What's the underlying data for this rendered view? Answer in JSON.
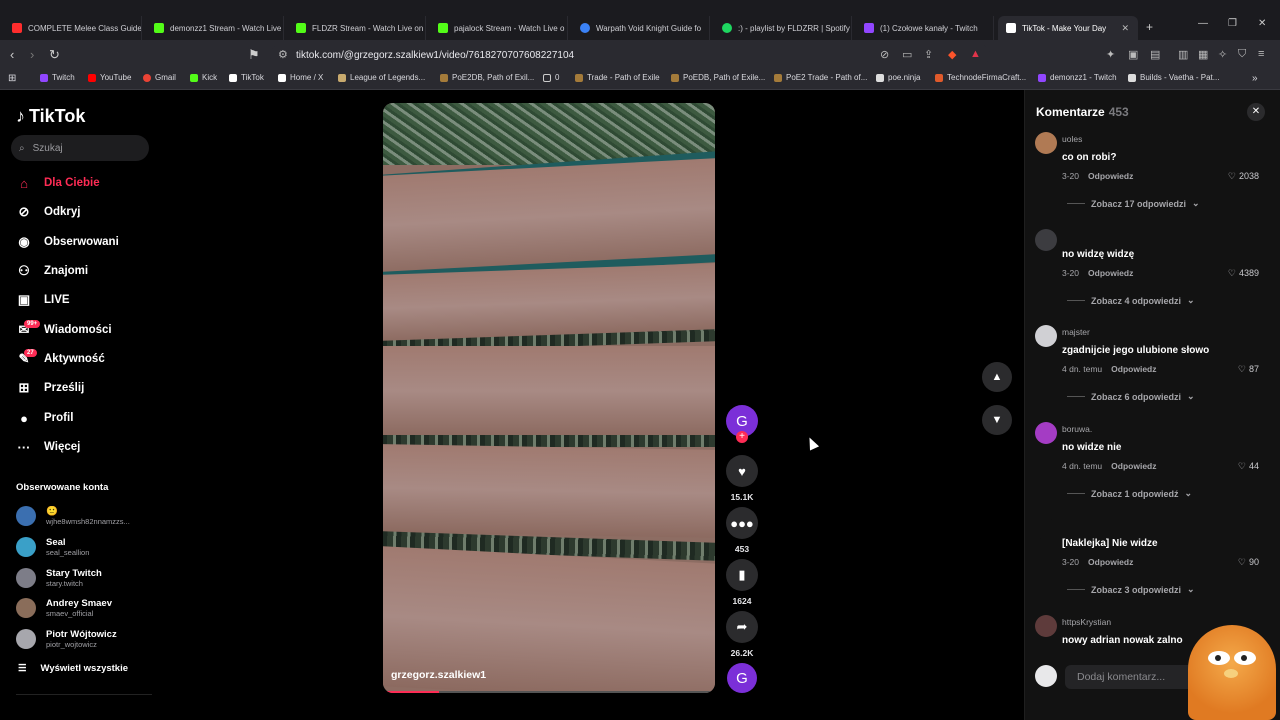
{
  "browser": {
    "tabs": [
      {
        "label": "COMPLETE Melee Class Guide f",
        "color": "#ff2d2d"
      },
      {
        "label": "demonzz1 Stream - Watch Live",
        "color": "#53fc18"
      },
      {
        "label": "FLDZR Stream - Watch Live on",
        "color": "#53fc18"
      },
      {
        "label": "pajalock Stream - Watch Live o",
        "color": "#53fc18"
      },
      {
        "label": "Warpath Void Knight Guide fo",
        "color": "#3b82f6"
      },
      {
        "label": ":) - playlist by FLDZRR | Spotify",
        "color": "#1ed760"
      },
      {
        "label": "(1) Czołowe kanały - Twitch",
        "color": "#9146ff"
      },
      {
        "label": "TikTok - Make Your Day",
        "color": "#ffffff"
      }
    ],
    "url": "tiktok.com/@grzegorz.szalkiew1/video/7618270707608227104",
    "bookmarks": [
      {
        "label": "Twitch",
        "color": "#9146ff"
      },
      {
        "label": "YouTube",
        "color": "#ff0000"
      },
      {
        "label": "Gmail",
        "color": "#ea4335"
      },
      {
        "label": "Kick",
        "color": "#53fc18"
      },
      {
        "label": "TikTok",
        "color": "#ffffff"
      },
      {
        "label": "Home / X",
        "color": "#ffffff"
      },
      {
        "label": "League of Legends...",
        "color": "#c8aa6e"
      },
      {
        "label": "PoE2DB, Path of Exil...",
        "color": "#a47b3a"
      },
      {
        "label": "0",
        "color": "#888888"
      },
      {
        "label": "Trade - Path of Exile",
        "color": "#a47b3a"
      },
      {
        "label": "PoEDB, Path of Exile...",
        "color": "#a47b3a"
      },
      {
        "label": "PoE2 Trade - Path of...",
        "color": "#a47b3a"
      },
      {
        "label": "poe.ninja",
        "color": "#dddddd"
      },
      {
        "label": "TechnodeFirmaCraft...",
        "color": "#e05a2b"
      },
      {
        "label": "demonzz1 - Twitch",
        "color": "#9146ff"
      },
      {
        "label": "Builds - Vaetha - Pat...",
        "color": "#dddddd"
      }
    ]
  },
  "tiktok": {
    "logo": "TikTok",
    "search_placeholder": "Szukaj",
    "nav": [
      {
        "label": "Dla Ciebie",
        "icon": "home-icon"
      },
      {
        "label": "Odkryj",
        "icon": "compass-icon"
      },
      {
        "label": "Obserwowani",
        "icon": "following-icon"
      },
      {
        "label": "Znajomi",
        "icon": "friends-icon"
      },
      {
        "label": "LIVE",
        "icon": "live-icon"
      },
      {
        "label": "Wiadomości",
        "icon": "messages-icon",
        "badge": "99+"
      },
      {
        "label": "Aktywność",
        "icon": "activity-icon",
        "badge": "27"
      },
      {
        "label": "Prześlij",
        "icon": "upload-icon"
      },
      {
        "label": "Profil",
        "icon": "profile-icon"
      },
      {
        "label": "Więcej",
        "icon": "more-icon"
      }
    ],
    "followed_title": "Obserwowane konta",
    "followed": [
      {
        "name": "",
        "handle": "wjhe8wmsh82nnamzzs..."
      },
      {
        "name": "Seal",
        "handle": "seal_seallion"
      },
      {
        "name": "Stary Twitch",
        "handle": "stary.twitch"
      },
      {
        "name": "Andrey Smaev",
        "handle": "smaev_official"
      },
      {
        "name": "Piotr Wójtowicz",
        "handle": "piotr_wojtowicz"
      }
    ],
    "show_all": "Wyświetl wszystkie"
  },
  "video": {
    "author": "grzegorz.szalkiew1",
    "progress": 0.17,
    "avatar_letter": "G",
    "likes": "15.1K",
    "comments": "453",
    "saves": "1624",
    "shares": "26.2K"
  },
  "comments_panel": {
    "title": "Komentarze",
    "count": "453",
    "input_placeholder": "Dodaj komentarz...",
    "items": [
      {
        "user": "uoles",
        "text": "co on robi?",
        "time": "3-20",
        "reply": "Odpowiedz",
        "likes": "2038",
        "more": "Zobacz 17 odpowiedzi"
      },
      {
        "user": "",
        "text": "no widzę widzę",
        "time": "3-20",
        "reply": "Odpowiedz",
        "likes": "4389",
        "more": "Zobacz 4 odpowiedzi"
      },
      {
        "user": "majster",
        "text": "zgadnijcie jego ulubione słowo",
        "time": "4 dn. temu",
        "reply": "Odpowiedz",
        "likes": "87",
        "more": "Zobacz 6 odpowiedzi"
      },
      {
        "user": "boruwa.",
        "text": "no widze nie",
        "time": "4 dn. temu",
        "reply": "Odpowiedz",
        "likes": "44",
        "more": "Zobacz 1 odpowiedź"
      },
      {
        "user": "",
        "text": "[Naklejka] Nie widze",
        "time": "3-20",
        "reply": "Odpowiedz",
        "likes": "90",
        "more": "Zobacz 3 odpowiedzi"
      },
      {
        "user": "httpsKrystian",
        "text": "nowy adrian nowak zalno",
        "time": "",
        "reply": "",
        "likes": "",
        "more": ""
      }
    ]
  },
  "colors": {
    "accent": "#fe2c55",
    "panel": "#121212"
  }
}
